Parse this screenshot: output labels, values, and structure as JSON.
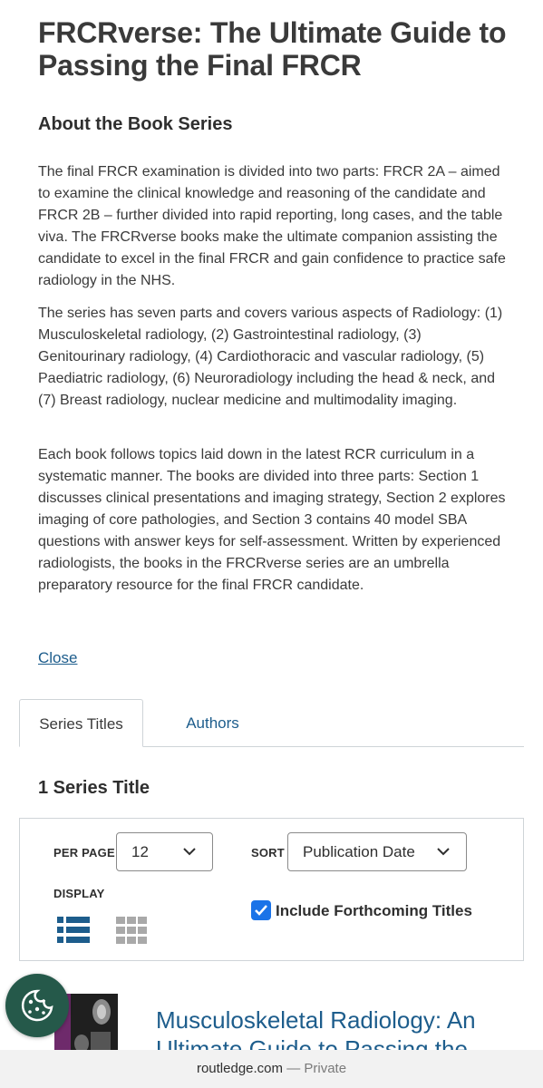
{
  "page": {
    "title": "FRCRverse: The Ultimate Guide to Passing the Final FRCR",
    "about_heading": "About the Book Series",
    "paragraphs": [
      "The final FRCR examination is divided into two parts: FRCR 2A – aimed to examine the clinical knowledge and reasoning of the candidate and FRCR 2B – further divided into rapid reporting, long cases, and the table viva. The FRCRverse books make the ultimate companion assisting the candidate to excel in the final FRCR and gain confidence to practice safe radiology in the NHS.",
      "The series has seven parts and covers various aspects of Radiology: (1) Musculoskeletal radiology, (2) Gastrointestinal radiology, (3) Genitourinary radiology, (4) Cardiothoracic and vascular radiology, (5) Paediatric radiology, (6) Neuroradiology including the head & neck, and (7) Breast radiology, nuclear medicine and multimodality imaging.",
      "Each book follows topics laid down in the latest RCR curriculum in a systematic manner. The books are divided into three parts: Section 1 discusses clinical presentations and imaging strategy, Section 2 explores imaging of core pathologies, and Section 3 contains 40 model SBA questions with answer keys for self-assessment. Written by experienced radiologists, the books in the FRCRverse series are an umbrella preparatory resource for the final FRCR candidate."
    ],
    "close_label": "Close"
  },
  "tabs": [
    {
      "label": "Series Titles",
      "active": true
    },
    {
      "label": "Authors",
      "active": false
    }
  ],
  "results": {
    "count_label": "1 Series Title"
  },
  "controls": {
    "per_page_label": "PER PAGE",
    "per_page_value": "12",
    "sort_label": "SORT",
    "sort_value": "Publication Date",
    "display_label": "DISPLAY",
    "display_mode": "list",
    "include_forthcoming_label": "Include Forthcoming Titles",
    "include_forthcoming_checked": true
  },
  "books": [
    {
      "title": "Musculoskeletal Radiology: An Ultimate Guide to Passing the"
    }
  ],
  "browser": {
    "domain": "routledge.com",
    "separator": "—",
    "mode": "Private"
  },
  "colors": {
    "link": "#1d5d8c",
    "checkbox": "#1a73e8",
    "cookie_button": "#25594a",
    "icon_active": "#1d5d8c",
    "icon_inactive": "#a9a9a9"
  }
}
